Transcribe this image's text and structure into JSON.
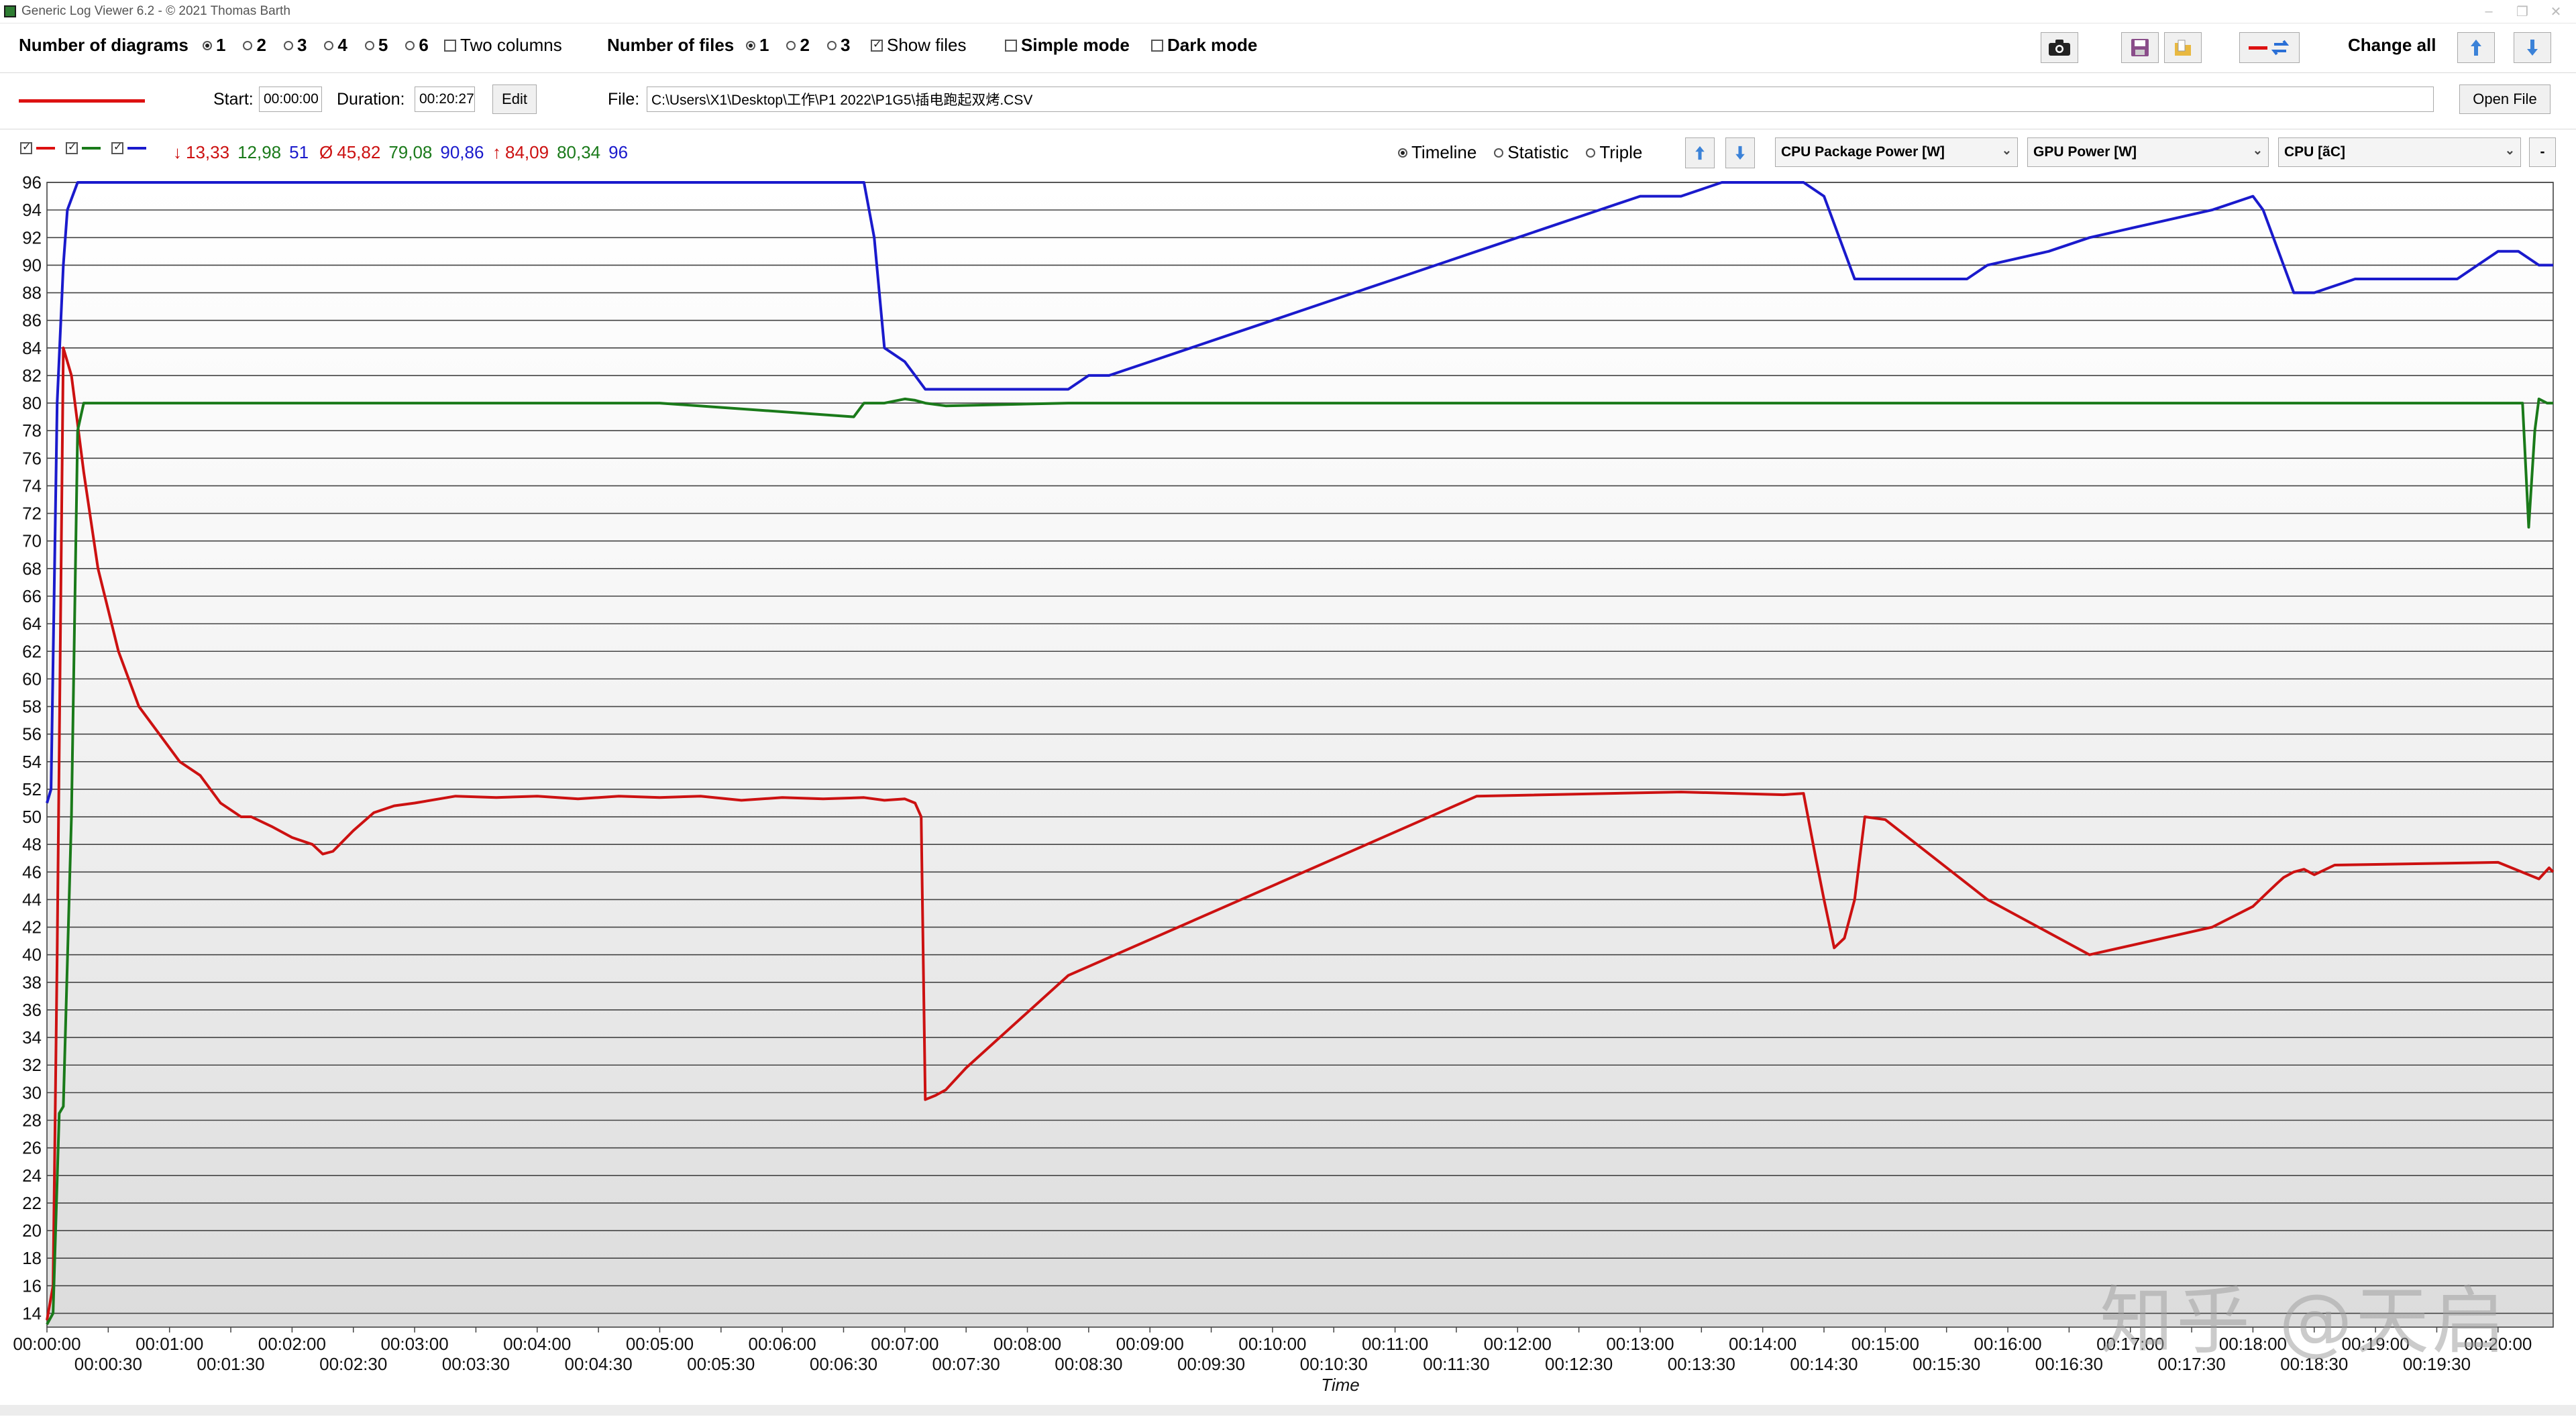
{
  "window": {
    "title": "Generic Log Viewer 6.2 - © 2021 Thomas Barth"
  },
  "toolbar": {
    "num_diagrams_label": "Number of diagrams",
    "diagram_options": [
      "1",
      "2",
      "3",
      "4",
      "5",
      "6"
    ],
    "diagram_selected": "1",
    "two_columns_label": "Two columns",
    "num_files_label": "Number of files",
    "file_options": [
      "1",
      "2",
      "3"
    ],
    "file_selected": "1",
    "show_files_label": "Show files",
    "simple_mode_label": "Simple mode",
    "dark_mode_label": "Dark mode",
    "change_all_label": "Change all"
  },
  "file_row": {
    "start_label": "Start:",
    "start_value": "00:00:00",
    "duration_label": "Duration:",
    "duration_value": "00:20:27",
    "edit_label": "Edit",
    "file_label": "File:",
    "file_path": "C:\\Users\\X1\\Desktop\\工作\\P1 2022\\P1G5\\插电跑起双烤.CSV",
    "open_file_label": "Open File"
  },
  "stats": {
    "min_label": "↓",
    "min_values": [
      "13,33",
      "12,98",
      "51"
    ],
    "avg_label": "Ø",
    "avg_values": [
      "45,82",
      "79,08",
      "90,86"
    ],
    "max_label": "↑",
    "max_values": [
      "84,09",
      "80,34",
      "96"
    ]
  },
  "view_mode": {
    "options": [
      "Timeline",
      "Statistic",
      "Triple"
    ],
    "selected": "Timeline"
  },
  "channels": [
    {
      "name": "CPU Package Power [W]",
      "color": "#cc1111"
    },
    {
      "name": "GPU Power [W]",
      "color": "#1a7a1a"
    },
    {
      "name": "CPU [ãC]",
      "color": "#1a1acc"
    }
  ],
  "minus_label": "-",
  "watermark": "知乎 @天启",
  "chart_data": {
    "type": "line",
    "xlabel": "Time",
    "ylim": [
      13,
      96
    ],
    "xlim": [
      0,
      1227
    ],
    "y_ticks": [
      14,
      16,
      18,
      20,
      22,
      24,
      26,
      28,
      30,
      32,
      34,
      36,
      38,
      40,
      42,
      44,
      46,
      48,
      50,
      52,
      54,
      56,
      58,
      60,
      62,
      64,
      66,
      68,
      70,
      72,
      74,
      76,
      78,
      80,
      82,
      84,
      86,
      88,
      90,
      92,
      94,
      96
    ],
    "x_ticks_major": [
      "00:00:00",
      "00:01:00",
      "00:02:00",
      "00:03:00",
      "00:04:00",
      "00:05:00",
      "00:06:00",
      "00:07:00",
      "00:08:00",
      "00:09:00",
      "00:10:00",
      "00:11:00",
      "00:12:00",
      "00:13:00",
      "00:14:00",
      "00:15:00",
      "00:16:00",
      "00:17:00",
      "00:18:00",
      "00:19:00",
      "00:20:00"
    ],
    "x_ticks_minor": [
      "00:00:30",
      "00:01:30",
      "00:02:30",
      "00:03:30",
      "00:04:30",
      "00:05:30",
      "00:06:30",
      "00:07:30",
      "00:08:30",
      "00:09:30",
      "00:10:30",
      "00:11:30",
      "00:12:30",
      "00:13:30",
      "00:14:30",
      "00:15:30",
      "00:16:30",
      "00:17:30",
      "00:18:30",
      "00:19:30"
    ],
    "series": [
      {
        "color": "#cc1111",
        "x": [
          0,
          3,
          5,
          8,
          12,
          18,
          25,
          35,
          45,
          55,
          65,
          75,
          85,
          95,
          100,
          110,
          120,
          130,
          135,
          140,
          150,
          160,
          170,
          180,
          200,
          220,
          240,
          260,
          280,
          300,
          320,
          340,
          360,
          380,
          400,
          410,
          420,
          425,
          428,
          430,
          435,
          440,
          450,
          500,
          600,
          700,
          800,
          850,
          860,
          866,
          870,
          875,
          880,
          885,
          890,
          900,
          950,
          1000,
          1060,
          1080,
          1087,
          1092,
          1095,
          1100,
          1105,
          1110,
          1120,
          1200,
          1220,
          1225,
          1227
        ],
        "y": [
          13.5,
          16,
          40,
          84,
          82,
          75,
          68,
          62,
          58,
          56,
          54,
          53,
          51,
          50,
          50,
          49.3,
          48.5,
          48,
          47.3,
          47.5,
          49,
          50.3,
          50.8,
          51,
          51.5,
          51.4,
          51.5,
          51.3,
          51.5,
          51.4,
          51.5,
          51.2,
          51.4,
          51.3,
          51.4,
          51.2,
          51.3,
          51,
          50,
          29.5,
          29.8,
          30.2,
          31.8,
          38.5,
          45,
          51.5,
          51.8,
          51.6,
          51.7,
          47,
          44,
          40.5,
          41.2,
          44,
          50,
          49.8,
          44,
          40,
          42,
          43.5,
          44.5,
          45.2,
          45.6,
          46,
          46.2,
          45.8,
          46.5,
          46.7,
          45.5,
          46.3,
          46
        ]
      },
      {
        "color": "#1a7a1a",
        "x": [
          0,
          3,
          6,
          8,
          12,
          15,
          18,
          20,
          30,
          100,
          200,
          300,
          395,
          400,
          410,
          420,
          425,
          430,
          440,
          500,
          700,
          900,
          1100,
          1200,
          1212,
          1215,
          1218,
          1220,
          1224,
          1227
        ],
        "y": [
          13.2,
          14,
          28.5,
          29,
          50,
          78,
          80,
          80,
          80,
          80,
          80,
          80,
          79,
          80,
          80,
          80.3,
          80.2,
          80,
          79.8,
          80,
          80,
          80,
          80,
          80,
          80,
          71,
          78,
          80.3,
          80,
          80
        ]
      },
      {
        "color": "#1a1acc",
        "x": [
          0,
          2,
          5,
          8,
          10,
          15,
          20,
          30,
          100,
          200,
          300,
          390,
          400,
          405,
          410,
          420,
          425,
          430,
          440,
          500,
          510,
          520,
          540,
          560,
          580,
          600,
          620,
          640,
          660,
          680,
          700,
          720,
          740,
          760,
          780,
          800,
          820,
          840,
          860,
          870,
          875,
          880,
          885,
          900,
          940,
          950,
          980,
          1000,
          1030,
          1060,
          1080,
          1085,
          1090,
          1095,
          1100,
          1110,
          1130,
          1150,
          1180,
          1190,
          1200,
          1210,
          1220,
          1227
        ],
        "y": [
          51,
          52,
          80,
          90,
          94,
          96,
          96,
          96,
          96,
          96,
          96,
          96,
          96,
          92,
          84,
          83,
          82,
          81,
          81,
          81,
          82,
          82,
          83,
          84,
          85,
          86,
          87,
          88,
          89,
          90,
          91,
          92,
          93,
          94,
          95,
          95,
          96,
          96,
          96,
          95,
          93,
          91,
          89,
          89,
          89,
          90,
          91,
          92,
          93,
          94,
          95,
          94,
          92,
          90,
          88,
          88,
          89,
          89,
          89,
          90,
          91,
          91,
          90,
          90
        ]
      }
    ]
  }
}
